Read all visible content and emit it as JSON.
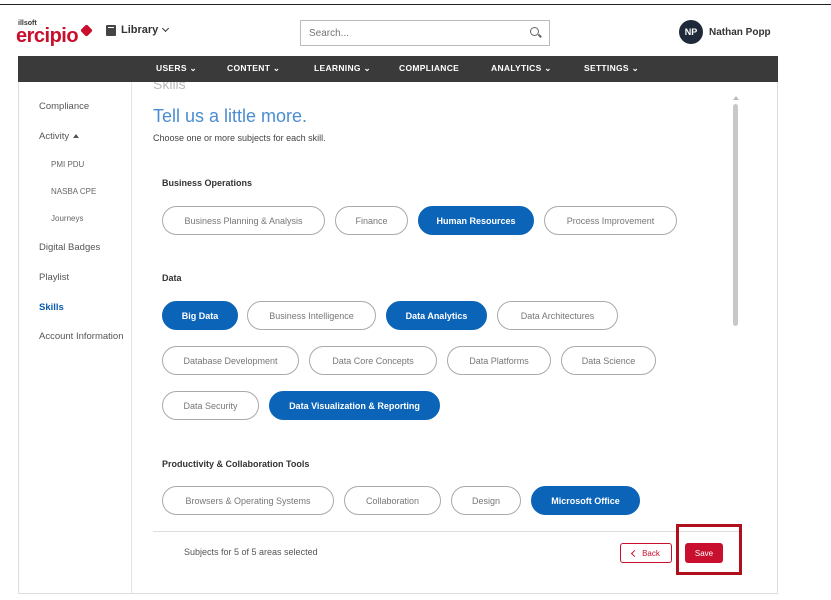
{
  "header": {
    "brand_small": "illsoft",
    "brand": "ercipio",
    "library_label": "Library",
    "search_placeholder": "Search...",
    "user_initials": "NP",
    "user_name": "Nathan Popp"
  },
  "nav": {
    "items": [
      {
        "label": "USERS"
      },
      {
        "label": "CONTENT"
      },
      {
        "label": "LEARNING"
      },
      {
        "label": "COMPLIANCE"
      },
      {
        "label": "ANALYTICS"
      },
      {
        "label": "SETTINGS"
      }
    ]
  },
  "sidebar": {
    "items": [
      {
        "label": "Compliance"
      },
      {
        "label": "Activity"
      },
      {
        "label": "PMI PDU"
      },
      {
        "label": "NASBA CPE"
      },
      {
        "label": "Journeys"
      },
      {
        "label": "Digital Badges"
      },
      {
        "label": "Playlist"
      },
      {
        "label": "Skills"
      },
      {
        "label": "Account Information"
      }
    ]
  },
  "main": {
    "partial_heading": "Skills",
    "heading": "Tell us a little more.",
    "subheading": "Choose one or more subjects for each skill.",
    "groups": [
      {
        "title": "Business Operations",
        "options": [
          {
            "label": "Business Planning & Analysis",
            "selected": false
          },
          {
            "label": "Finance",
            "selected": false
          },
          {
            "label": "Human Resources",
            "selected": true
          },
          {
            "label": "Process Improvement",
            "selected": false
          }
        ]
      },
      {
        "title": "Data",
        "options": [
          {
            "label": "Big Data",
            "selected": true
          },
          {
            "label": "Business Intelligence",
            "selected": false
          },
          {
            "label": "Data Analytics",
            "selected": true
          },
          {
            "label": "Data Architectures",
            "selected": false
          },
          {
            "label": "Database Development",
            "selected": false
          },
          {
            "label": "Data Core Concepts",
            "selected": false
          },
          {
            "label": "Data Platforms",
            "selected": false
          },
          {
            "label": "Data Science",
            "selected": false
          },
          {
            "label": "Data Security",
            "selected": false
          },
          {
            "label": "Data Visualization & Reporting",
            "selected": true
          }
        ]
      },
      {
        "title": "Productivity & Collaboration Tools",
        "options": [
          {
            "label": "Browsers & Operating Systems",
            "selected": false
          },
          {
            "label": "Collaboration",
            "selected": false
          },
          {
            "label": "Design",
            "selected": false
          },
          {
            "label": "Microsoft Office",
            "selected": true
          }
        ]
      }
    ],
    "footer_text": "Subjects for 5 of 5 areas selected",
    "back_label": "Back",
    "save_label": "Save"
  },
  "colors": {
    "brand_red": "#c8102e",
    "selected_blue": "#0b64b8",
    "nav_bg": "#3a3a3a",
    "heading_blue": "#4a8dd0",
    "highlight": "#b0101c"
  }
}
